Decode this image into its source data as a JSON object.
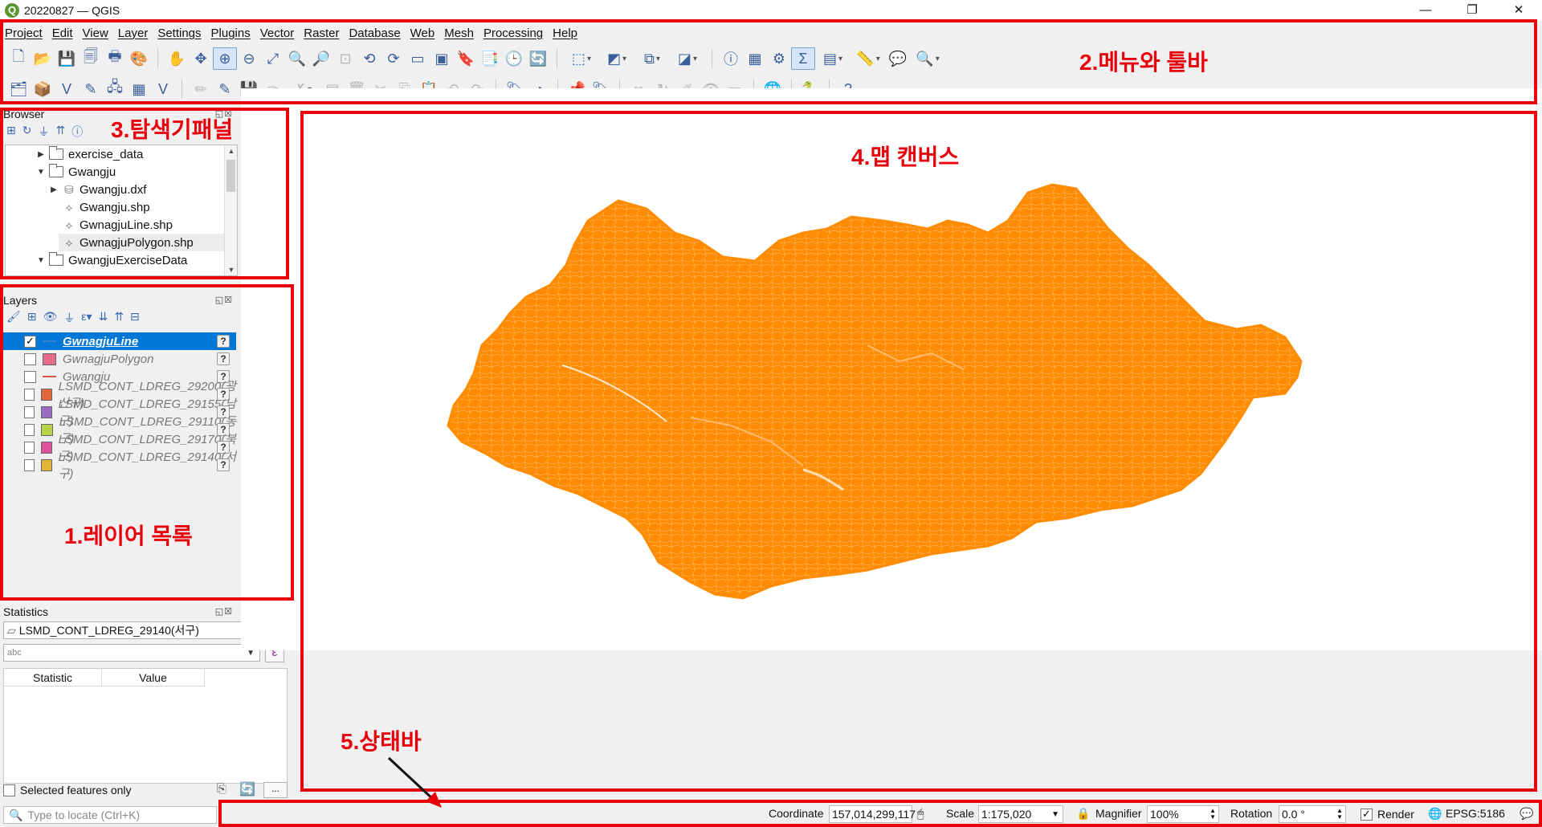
{
  "window": {
    "title": "20220827 — QGIS",
    "minimize": "—",
    "restore": "❐",
    "close": "✕"
  },
  "menu": [
    "Project",
    "Edit",
    "View",
    "Layer",
    "Settings",
    "Plugins",
    "Vector",
    "Raster",
    "Database",
    "Web",
    "Mesh",
    "Processing",
    "Help"
  ],
  "annotations": {
    "menu_toolbar": "2.메뉴와 툴바",
    "browser": "3.탐색기패널",
    "map_canvas": "4.맵 캔버스",
    "layers": "1.레이어 목록",
    "statusbar": "5.상태바"
  },
  "browser": {
    "title": "Browser",
    "items": [
      {
        "label": "exercise_data",
        "type": "folder",
        "expanded": false
      },
      {
        "label": "Gwangju",
        "type": "folder",
        "expanded": true
      },
      {
        "label": "Gwangju.dxf",
        "type": "dxf",
        "expanded": false
      },
      {
        "label": "Gwangju.shp",
        "type": "vector"
      },
      {
        "label": "GwnagjuLine.shp",
        "type": "vector"
      },
      {
        "label": "GwnagjuPolygon.shp",
        "type": "vector"
      },
      {
        "label": "GwangjuExerciseData",
        "type": "folder",
        "expanded": true
      }
    ]
  },
  "layers": {
    "title": "Layers",
    "items": [
      {
        "name": "GwnagjuLine",
        "checked": true,
        "selected": true,
        "color": "#3d7fd1",
        "kind": "line"
      },
      {
        "name": "GwnagjuPolygon",
        "checked": false,
        "color": "#e96b8a",
        "kind": "fill"
      },
      {
        "name": "Gwangju",
        "checked": false,
        "color": "#d9534f",
        "kind": "line"
      },
      {
        "name": "LSMD_CONT_LDREG_29200(광산구)",
        "checked": false,
        "color": "#e2663b",
        "kind": "fill"
      },
      {
        "name": "LSMD_CONT_LDREG_29155(남구)",
        "checked": false,
        "color": "#9a6bc2",
        "kind": "fill"
      },
      {
        "name": "LSMD_CONT_LDREG_29110(동구)",
        "checked": false,
        "color": "#b5d44a",
        "kind": "fill"
      },
      {
        "name": "LSMD_CONT_LDREG_29170(북구)",
        "checked": false,
        "color": "#e0519b",
        "kind": "fill"
      },
      {
        "name": "LSMD_CONT_LDREG_29140(서구)",
        "checked": false,
        "color": "#e2b43a",
        "kind": "fill"
      }
    ]
  },
  "statistics": {
    "title": "Statistics",
    "layer": "LSMD_CONT_LDREG_29140(서구)",
    "field_placeholder": "abc",
    "columns": [
      "Statistic",
      "Value"
    ],
    "selected_only": "Selected features only",
    "more": "..."
  },
  "locator": {
    "placeholder": "Type to locate (Ctrl+K)"
  },
  "statusbar": {
    "coordinate_label": "Coordinate",
    "coordinate": "157,014,299,117",
    "scale_label": "Scale",
    "scale": "1:175,020",
    "magnifier_label": "Magnifier",
    "magnifier": "100%",
    "rotation_label": "Rotation",
    "rotation": "0.0 °",
    "render_label": "Render",
    "render_checked": true,
    "crs": "EPSG:5186"
  },
  "map": {
    "feature_color": "#ff8c00"
  }
}
